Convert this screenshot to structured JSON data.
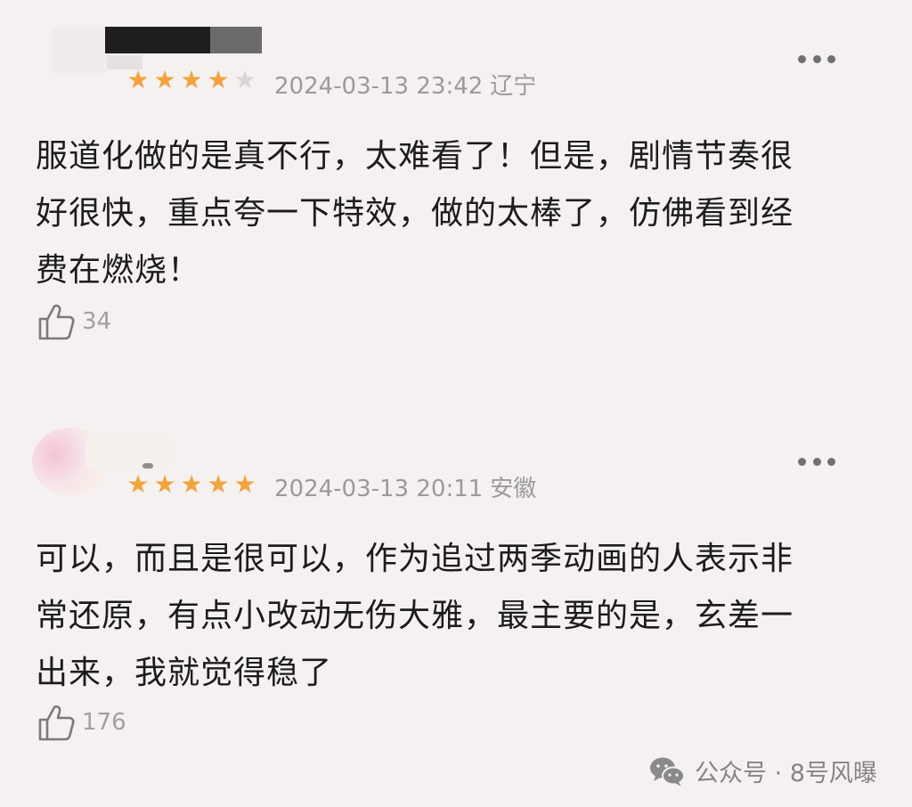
{
  "reviews": [
    {
      "stars": 4,
      "max_stars": 5,
      "date": "2024-03-13 23:42",
      "region": "辽宁",
      "content_lines": [
        "服道化做的是真不行，太难看了！但是，剧情节奏很",
        "好很快，重点夸一下特效，做的太棒了，仿佛看到经",
        "费在燃烧！"
      ],
      "likes": "34"
    },
    {
      "stars": 5,
      "max_stars": 5,
      "date": "2024-03-13 20:11",
      "region": "安徽",
      "content_lines": [
        "可以，而且是很可以，作为追过两季动画的人表示非",
        "常还原，有点小改动无伤大雅，最主要的是，玄差一",
        "出来，我就觉得稳了"
      ],
      "likes": "176"
    }
  ],
  "icons": {
    "more": "more-icon",
    "like": "thumbs-up-icon",
    "wechat": "wechat-icon"
  },
  "colors": {
    "star_on": "#f4a23a",
    "star_off": "#d8d4d4",
    "background": "#f6f1f1"
  },
  "watermark": {
    "text": "公众号 · 8号风曝"
  }
}
